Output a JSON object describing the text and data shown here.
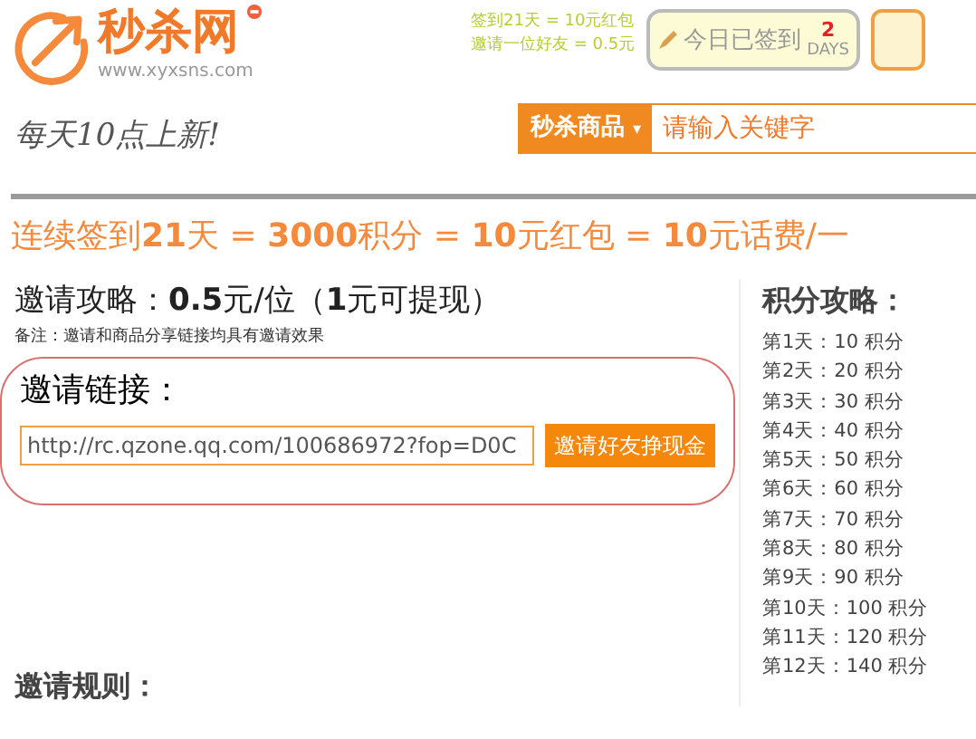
{
  "header": {
    "brand": "秒杀网",
    "url": "www.xyxsns.com",
    "slogan": "每天10点上新!",
    "promo_lines": [
      "签到21天 = 10元红包",
      "邀请一位好友 = 0.5元"
    ],
    "checkin": {
      "label": "今日已签到",
      "days": "2",
      "days_unit": "DAYS",
      "signed": true
    }
  },
  "search": {
    "category": "秒杀商品",
    "caret": "▾",
    "placeholder": "请输入关键字"
  },
  "banner": "连续签到**21**天 = **3000**积分 = **10**元红包 = **10**元话费/一",
  "invite": {
    "title": "邀请攻略：**0.5**元/位（**1**元可提现）",
    "note": "备注：邀请和商品分享链接均具有邀请效果",
    "link_label": "邀请链接：",
    "link_value": "http://rc.qzone.qq.com/100686972?fop=D0C",
    "button": "邀请好友挣现金",
    "rules_title": "邀请规则："
  },
  "points": {
    "title": "积分攻略：",
    "rows": [
      {
        "day": "第1天：",
        "points": "10 积分"
      },
      {
        "day": "第2天：",
        "points": "20 积分"
      },
      {
        "day": "第3天：",
        "points": "30 积分"
      },
      {
        "day": "第4天：",
        "points": "40 积分"
      },
      {
        "day": "第5天：",
        "points": "50 积分"
      },
      {
        "day": "第6天：",
        "points": "60 积分"
      },
      {
        "day": "第7天：",
        "points": "70 积分"
      },
      {
        "day": "第8天：",
        "points": "80 积分"
      },
      {
        "day": "第9天：",
        "points": "90 积分"
      },
      {
        "day": "第10天：",
        "points": "100 积分"
      },
      {
        "day": "第11天：",
        "points": "120 积分"
      },
      {
        "day": "第12天：",
        "points": "140 积分"
      }
    ]
  }
}
